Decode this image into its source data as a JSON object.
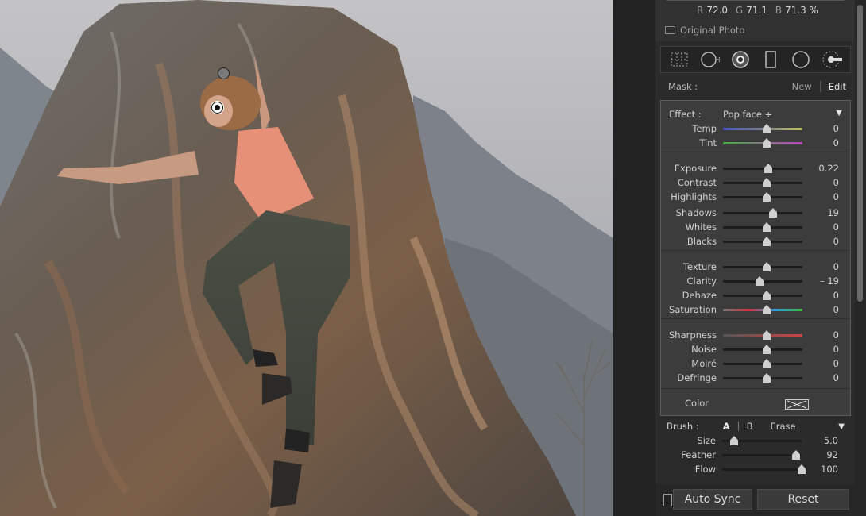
{
  "photo": {
    "description_icon": "photo-canvas",
    "pins": [
      "mask-pin-icon",
      "mask-pin-active-icon"
    ]
  },
  "readout": {
    "r_label": "R",
    "r_value": "72.0",
    "g_label": "G",
    "g_value": "71.1",
    "b_label": "B",
    "b_value": "71.3 %"
  },
  "original_photo": "Original Photo",
  "tools": [
    "crop-overlay-icon",
    "spot-removal-icon",
    "red-eye-icon",
    "graduated-filter-icon",
    "radial-filter-icon",
    "adjustment-brush-icon"
  ],
  "mask": {
    "label": "Mask :",
    "new": "New",
    "edit": "Edit"
  },
  "effect": {
    "label": "Effect :",
    "preset": "Pop face ÷",
    "groups": [
      [
        {
          "name": "Temp",
          "value": "0",
          "pos": 0.5,
          "track": "temp"
        },
        {
          "name": "Tint",
          "value": "0",
          "pos": 0.5,
          "track": "tint"
        }
      ],
      [
        {
          "name": "Exposure",
          "value": "0.22",
          "pos": 0.52
        },
        {
          "name": "Contrast",
          "value": "0",
          "pos": 0.5
        },
        {
          "name": "Highlights",
          "value": "0",
          "pos": 0.5
        },
        {
          "name": "Shadows",
          "value": "19",
          "pos": 0.58
        },
        {
          "name": "Whites",
          "value": "0",
          "pos": 0.5
        },
        {
          "name": "Blacks",
          "value": "0",
          "pos": 0.5
        }
      ],
      [
        {
          "name": "Texture",
          "value": "0",
          "pos": 0.5
        },
        {
          "name": "Clarity",
          "value": "– 19",
          "pos": 0.41
        },
        {
          "name": "Dehaze",
          "value": "0",
          "pos": 0.5
        },
        {
          "name": "Saturation",
          "value": "0",
          "pos": 0.5,
          "track": "sat"
        }
      ],
      [
        {
          "name": "Sharpness",
          "value": "0",
          "pos": 0.5,
          "track": "sharp"
        },
        {
          "name": "Noise",
          "value": "0",
          "pos": 0.5
        },
        {
          "name": "Moiré",
          "value": "0",
          "pos": 0.5
        },
        {
          "name": "Defringe",
          "value": "0",
          "pos": 0.5
        }
      ]
    ],
    "color_label": "Color"
  },
  "brush": {
    "label": "Brush :",
    "a": "A",
    "b": "B",
    "erase": "Erase",
    "sliders": [
      {
        "name": "Size",
        "value": "5.0",
        "pos": 0.1
      },
      {
        "name": "Feather",
        "value": "92",
        "pos": 0.88
      },
      {
        "name": "Flow",
        "value": "100",
        "pos": 0.95
      }
    ]
  },
  "buttons": {
    "auto_sync": "Auto Sync",
    "reset": "Reset"
  },
  "colors": {
    "panel": "#2b2b2b",
    "effect_box": "#3c3c3c",
    "accent_text": "#e4e4e4"
  }
}
